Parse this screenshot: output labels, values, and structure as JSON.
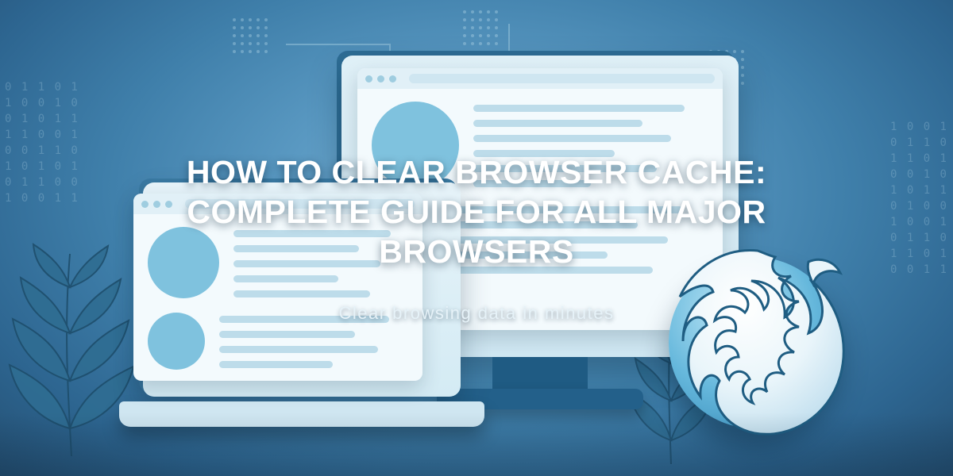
{
  "hero": {
    "title": "HOW TO CLEAR BROWSER CACHE: COMPLETE GUIDE FOR ALL MAJOR BROWSERS",
    "subtitle": "Clear browsing data in minutes"
  },
  "decor": {
    "binary_left": "0 1 1 0 1\n1 0 0 1 0\n0 1 0 1 1\n1 1 0 0 1\n0 0 1 1 0\n1 0 1 0 1\n0 1 1 0 0\n1 0 0 1 1",
    "binary_right": "1 0 0 1\n0 1 1 0\n1 1 0 1\n0 0 1 0\n1 0 1 1\n0 1 0 0\n1 0 0 1\n0 1 1 0\n1 1 0 1\n0 0 1 1"
  }
}
